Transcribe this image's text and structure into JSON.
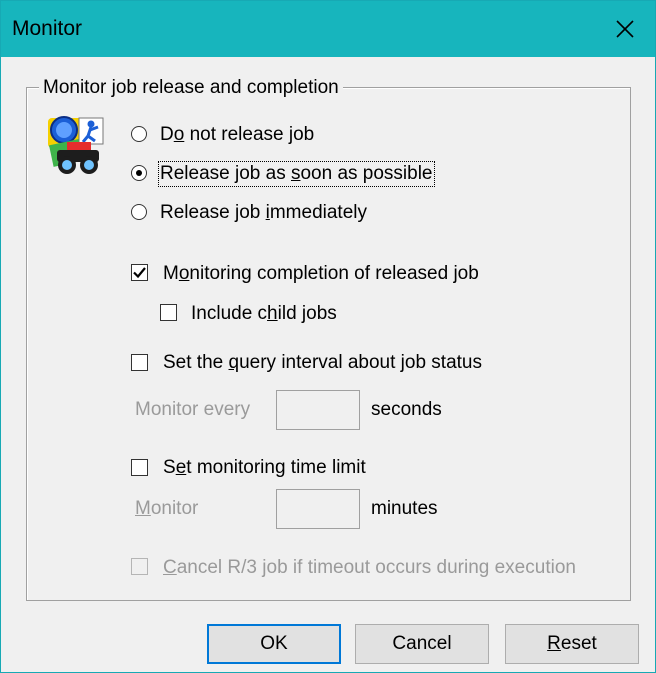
{
  "window": {
    "title": "Monitor",
    "close_icon": "close-icon"
  },
  "group": {
    "legend": "Monitor job release and completion",
    "logo_icon": "job-monitor-logo-icon",
    "release_options": [
      {
        "label_pre": "D",
        "label_u": "o",
        "label_post": " not release job",
        "selected": false
      },
      {
        "label_pre": "Release job as ",
        "label_u": "s",
        "label_post": "oon as possible",
        "selected": true
      },
      {
        "label_pre": "Release job ",
        "label_u": "i",
        "label_post": "mmediately",
        "selected": false
      }
    ],
    "monitor_completion": {
      "label_pre": "M",
      "label_u": "o",
      "label_post": "nitoring completion of released job",
      "checked": true
    },
    "include_child": {
      "label_pre": "Include c",
      "label_u": "h",
      "label_post": "ild jobs",
      "checked": false
    },
    "query_interval": {
      "label_pre": "Set the ",
      "label_u": "q",
      "label_post": "uery interval about job status",
      "checked": false
    },
    "monitor_every": {
      "label": "Monitor every",
      "value": "",
      "unit": "seconds"
    },
    "time_limit": {
      "label_pre": "S",
      "label_u": "e",
      "label_post": "t monitoring time limit",
      "checked": false
    },
    "monitor_minutes": {
      "label_u": "M",
      "label_post": "onitor",
      "value": "",
      "unit": "minutes"
    },
    "cancel_job": {
      "label_u": "C",
      "label_post": "ancel R/3 job if timeout occurs during execution",
      "checked": false
    }
  },
  "buttons": {
    "ok": "OK",
    "cancel": "Cancel",
    "reset_u": "R",
    "reset_post": "eset"
  }
}
